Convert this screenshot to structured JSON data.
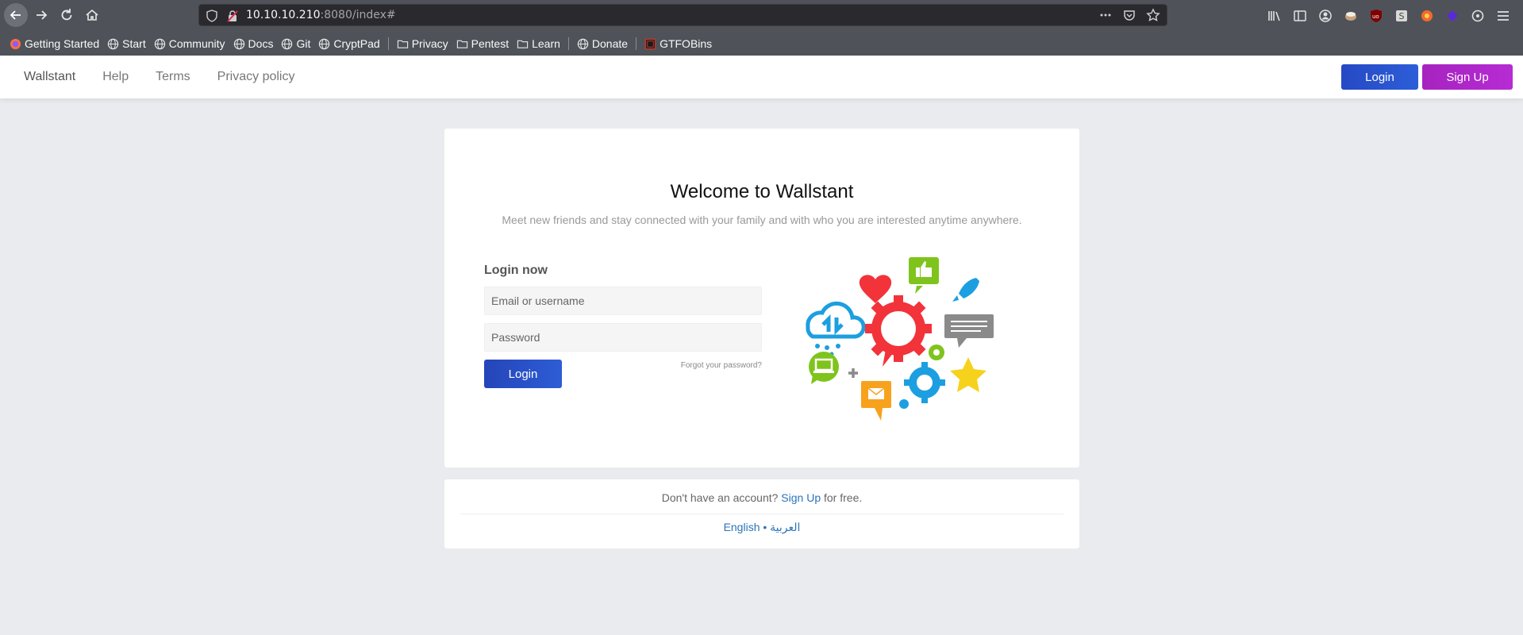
{
  "browser": {
    "url_host": "10.10.10.210",
    "url_rest": ":8080/index#",
    "bookmarks": [
      {
        "label": "Getting Started",
        "icon": "firefox-icon"
      },
      {
        "label": "Start",
        "icon": "globe-icon"
      },
      {
        "label": "Community",
        "icon": "globe-icon"
      },
      {
        "label": "Docs",
        "icon": "globe-icon"
      },
      {
        "label": "Git",
        "icon": "globe-icon"
      },
      {
        "label": "CryptPad",
        "icon": "globe-icon"
      },
      {
        "label": "Privacy",
        "icon": "folder-icon"
      },
      {
        "label": "Pentest",
        "icon": "folder-icon"
      },
      {
        "label": "Learn",
        "icon": "folder-icon"
      },
      {
        "label": "Donate",
        "icon": "globe-icon"
      },
      {
        "label": "GTFOBins",
        "icon": "gtfobins-icon"
      }
    ]
  },
  "nav": {
    "brand": "Wallstant",
    "help": "Help",
    "terms": "Terms",
    "privacy": "Privacy policy",
    "login": "Login",
    "signup": "Sign Up"
  },
  "main": {
    "title": "Welcome to Wallstant",
    "tagline": "Meet new friends and stay connected with your family and with who you are interested anytime anywhere.",
    "login_heading": "Login now",
    "email_placeholder": "Email or username",
    "password_placeholder": "Password",
    "login_button": "Login",
    "forgot": "Forgot your password?"
  },
  "footer": {
    "no_account": "Don't have an account?",
    "signup_link": "Sign Up",
    "for_free": "for free.",
    "lang_en": "English",
    "lang_sep": "•",
    "lang_ar": "العربية"
  },
  "colors": {
    "chrome": "#4f5359",
    "login_blue": "#2649c4",
    "signup_purple": "#a623c0",
    "link": "#2b74b9"
  }
}
